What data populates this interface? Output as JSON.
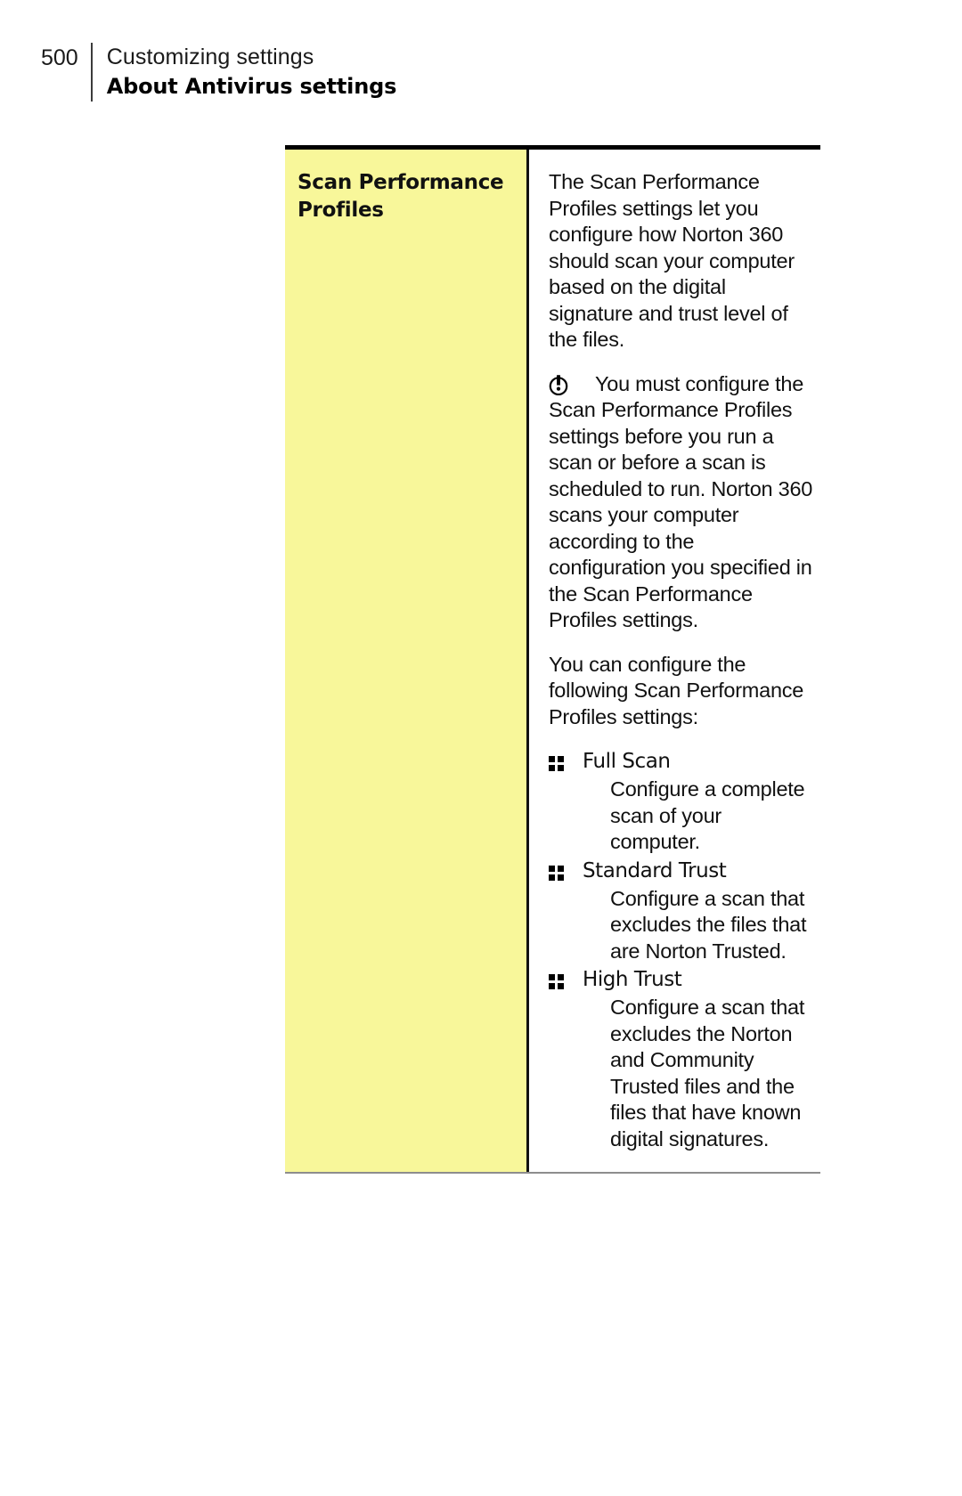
{
  "header": {
    "page_number": "500",
    "chapter": "Customizing settings",
    "section": "About Antivirus settings"
  },
  "colors": {
    "term_cell_background": "#F8F79A",
    "table_top_rule": "#000000",
    "table_bottom_rule": "#8D8D8D",
    "column_divider": "#111111",
    "text": "#111111"
  },
  "table": {
    "row": {
      "term": "Scan Performance Profiles",
      "definition": {
        "intro_paragraph": "The Scan Performance Profiles settings let you configure how Norton 360 should scan your computer based on the digital signature and trust level of the files.",
        "note": {
          "icon": "note-exclamation-icon",
          "text": "You must configure the Scan Performance Profiles settings before you run a scan or before a scan is scheduled to run. Norton 360 scans your computer according to the configuration you specified in the Scan Performance Profiles settings."
        },
        "list_intro": "You can configure the following Scan Performance Profiles settings:",
        "bullets": [
          {
            "label": "Full Scan",
            "description": "Configure a complete scan of your computer."
          },
          {
            "label": "Standard Trust",
            "description": "Configure a scan that excludes the files that are Norton Trusted."
          },
          {
            "label": "High Trust",
            "description": "Configure a scan that excludes the Norton and Community Trusted files and the files that have known digital signatures."
          }
        ]
      }
    }
  }
}
